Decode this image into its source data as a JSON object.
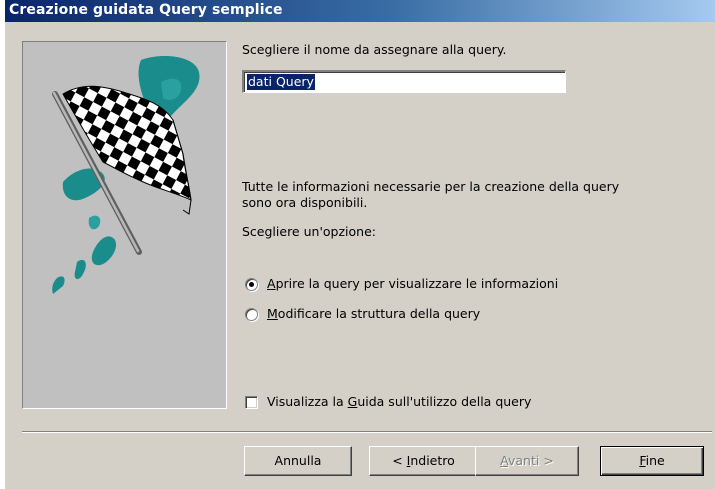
{
  "window": {
    "title": "Creazione guidata Query semplice"
  },
  "form": {
    "name_prompt": "Scegliere il nome da assegnare alla query.",
    "query_name_value": "dati Query",
    "info_line1": "Tutte le informazioni necessarie per la creazione della query",
    "info_line2": "sono ora disponibili.",
    "option_prompt": "Scegliere un'opzione:"
  },
  "options": [
    {
      "prefix": "",
      "mnemonic": "A",
      "rest": "prire la query per visualizzare le informazioni",
      "selected": true
    },
    {
      "prefix": "",
      "mnemonic": "M",
      "rest": "odificare la struttura della query",
      "selected": false
    }
  ],
  "help_checkbox": {
    "prefix": "Visualizza la ",
    "mnemonic": "G",
    "rest": "uida sull'utilizzo della query",
    "checked": false
  },
  "buttons": {
    "cancel": {
      "label": "Annulla"
    },
    "back": {
      "prefix": "< ",
      "mnemonic": "I",
      "rest": "ndietro"
    },
    "next": {
      "prefix": "",
      "mnemonic": "A",
      "rest": "vanti >",
      "enabled": false
    },
    "finish": {
      "prefix": "",
      "mnemonic": "F",
      "rest": "ine"
    }
  },
  "colors": {
    "dialog_bg": "#d4d0c8",
    "title_gradient_start": "#0a246a",
    "selection_bg": "#0a246a",
    "flag_teal": "#1a8c8c"
  },
  "icons": {
    "wizard_art": "checkered-flag-icon"
  }
}
